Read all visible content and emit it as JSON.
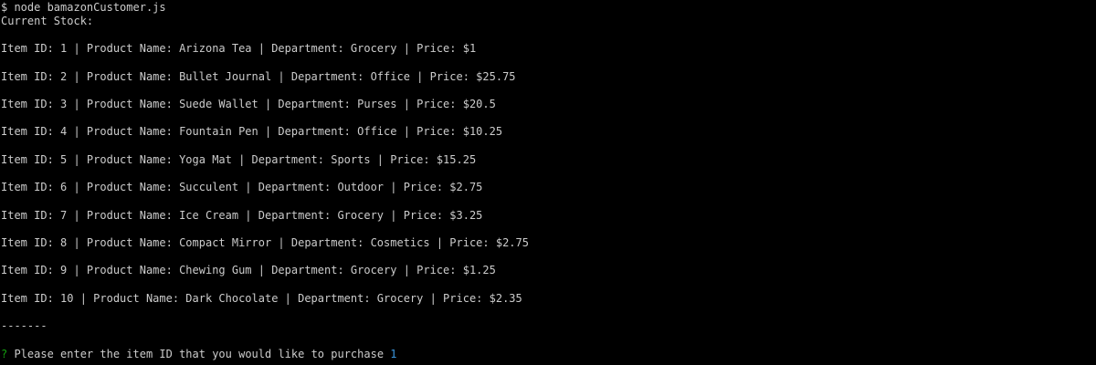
{
  "terminal": {
    "command_line": "$ node bamazonCustomer.js",
    "stock_heading": "Current Stock:",
    "items": [
      "Item ID: 1 | Product Name: Arizona Tea | Department: Grocery | Price: $1",
      "Item ID: 2 | Product Name: Bullet Journal | Department: Office | Price: $25.75",
      "Item ID: 3 | Product Name: Suede Wallet | Department: Purses | Price: $20.5",
      "Item ID: 4 | Product Name: Fountain Pen | Department: Office | Price: $10.25",
      "Item ID: 5 | Product Name: Yoga Mat | Department: Sports | Price: $15.25",
      "Item ID: 6 | Product Name: Succulent | Department: Outdoor | Price: $2.75",
      "Item ID: 7 | Product Name: Ice Cream | Department: Grocery | Price: $3.25",
      "Item ID: 8 | Product Name: Compact Mirror | Department: Cosmetics | Price: $2.75",
      "Item ID: 9 | Product Name: Chewing Gum | Department: Grocery | Price: $1.25",
      "Item ID: 10 | Product Name: Dark Chocolate | Department: Grocery | Price: $2.35"
    ],
    "separator": "-------",
    "prompt_mark": "?",
    "prompt_question": " Please enter the item ID that you would like to purchase ",
    "prompt_answer": "1",
    "colors": {
      "background": "#000000",
      "text": "#cccccc",
      "prompt_mark": "#13a10e",
      "answer": "#3a96dd"
    }
  }
}
